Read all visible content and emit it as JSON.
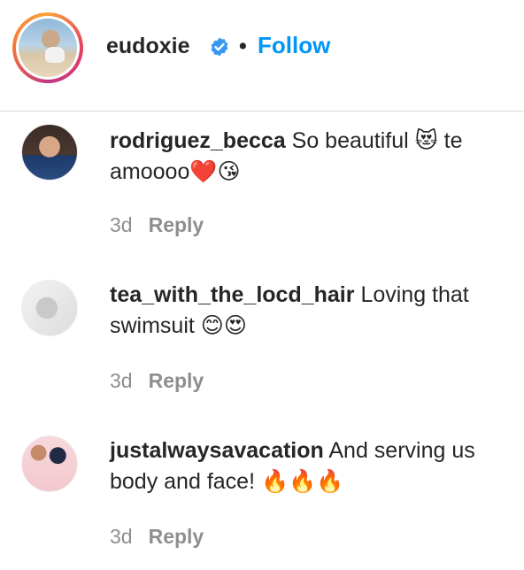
{
  "post_header": {
    "username": "eudoxie",
    "separator": "•",
    "follow_label": "Follow",
    "verified_color": "#3897f0",
    "follow_color": "#0095f6"
  },
  "comments": [
    {
      "author": "rodriguez_becca",
      "text": "So beautiful 😻 te amoooo❤️😘",
      "age": "3d",
      "reply_label": "Reply"
    },
    {
      "author": "tea_with_the_locd_hair",
      "text": "Loving that swimsuit 😊😍",
      "age": "3d",
      "reply_label": "Reply"
    },
    {
      "author": "justalwaysavacation",
      "text": "And serving us body and face! 🔥🔥🔥",
      "age": "3d",
      "reply_label": "Reply"
    }
  ]
}
